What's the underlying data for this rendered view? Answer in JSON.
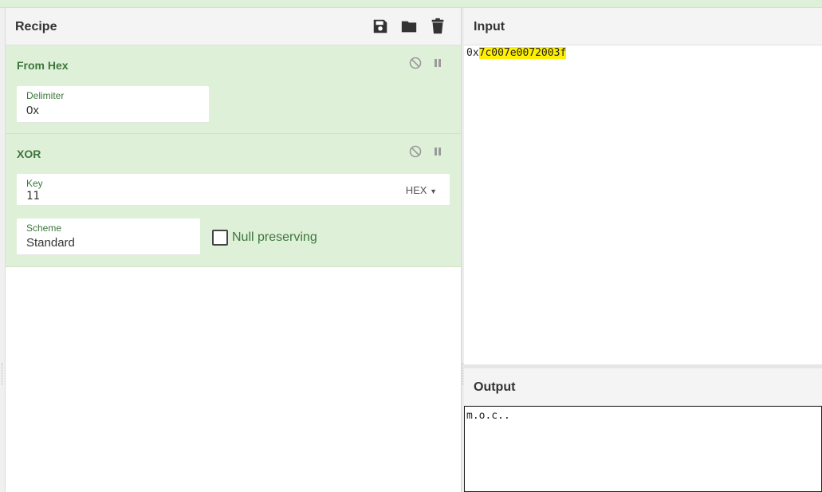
{
  "recipe": {
    "title": "Recipe",
    "icons": [
      "save-icon",
      "folder-icon",
      "trash-icon"
    ],
    "operations": [
      {
        "name": "From Hex",
        "fields": [
          {
            "label": "Delimiter",
            "value": "0x"
          }
        ]
      },
      {
        "name": "XOR",
        "key": {
          "label": "Key",
          "value": "11",
          "format": "HEX"
        },
        "scheme": {
          "label": "Scheme",
          "value": "Standard"
        },
        "null_preserving": {
          "label": "Null preserving",
          "checked": false
        }
      }
    ]
  },
  "input": {
    "title": "Input",
    "prefix": "0x",
    "highlighted": "7c007e0072003f"
  },
  "output": {
    "title": "Output",
    "text": "m.o.c.."
  },
  "colors": {
    "op_background": "#dff0d8",
    "op_text": "#3c763d",
    "highlight": "#ffef00"
  }
}
